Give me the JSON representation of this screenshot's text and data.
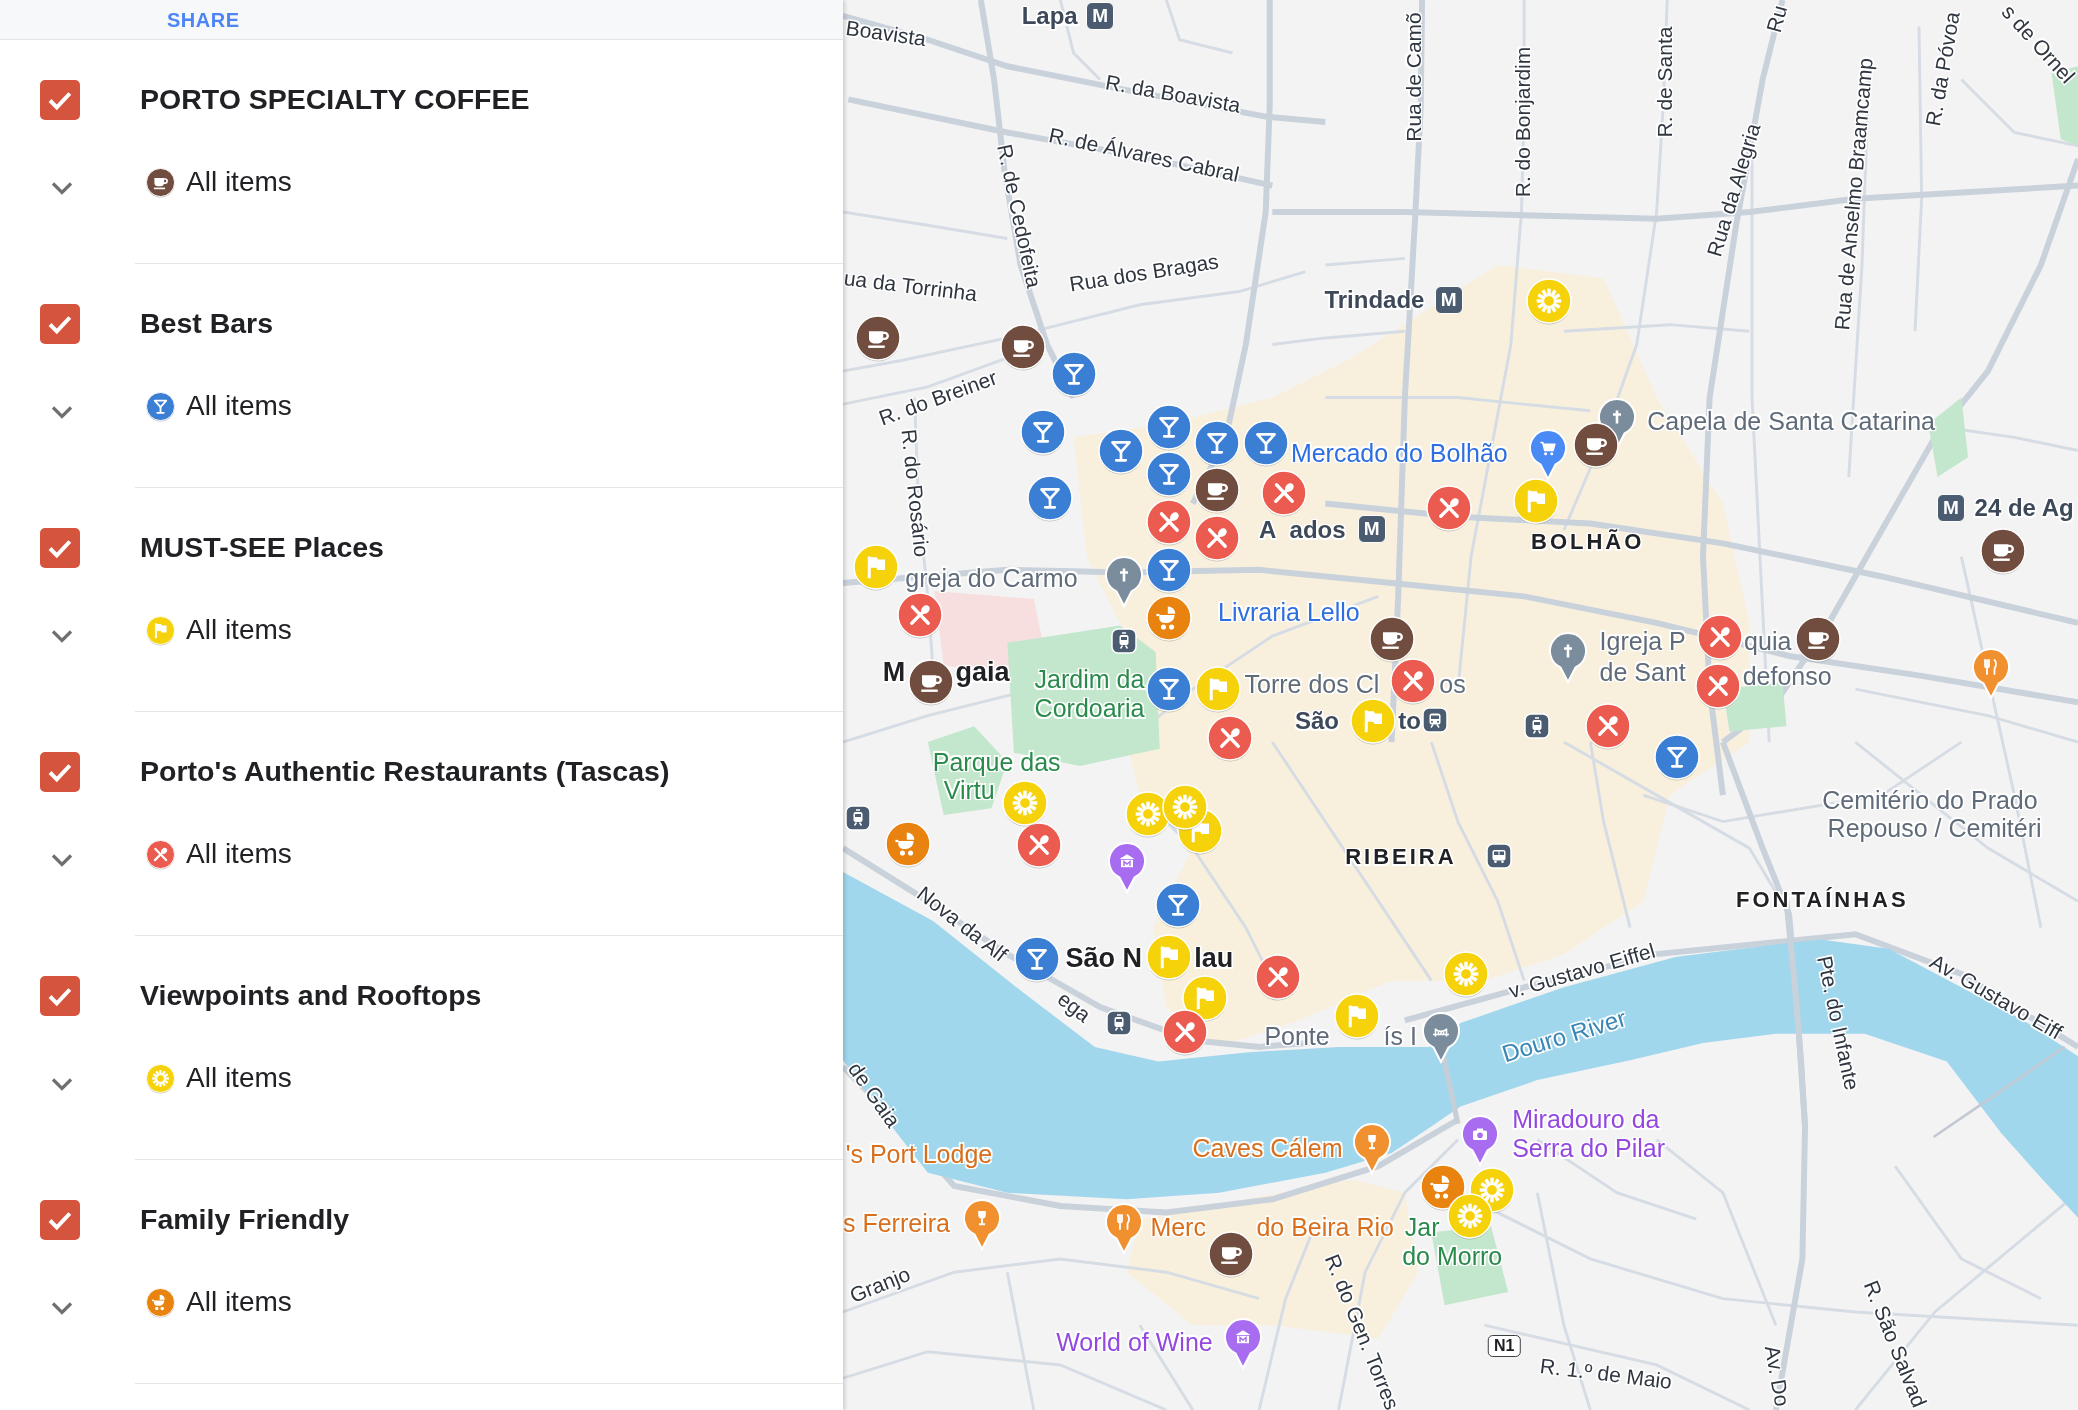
{
  "panel": {
    "share_label": "SHARE"
  },
  "layers": [
    {
      "title": "PORTO SPECIALTY COFFEE",
      "kind": "coffee",
      "color": "#714d3f",
      "checked": true,
      "expanded": false,
      "items_label": "All items"
    },
    {
      "title": "Best Bars",
      "kind": "bar",
      "color": "#3b7fd4",
      "checked": true,
      "expanded": false,
      "items_label": "All items"
    },
    {
      "title": "MUST-SEE Places",
      "kind": "sight",
      "color": "#f5d20a",
      "checked": true,
      "expanded": false,
      "items_label": "All items"
    },
    {
      "title": "Porto's Authentic Restaurants (Tascas)",
      "kind": "restaurant",
      "color": "#ec5b4f",
      "checked": true,
      "expanded": false,
      "items_label": "All items"
    },
    {
      "title": "Viewpoints and Rooftops",
      "kind": "viewpoint",
      "color": "#f5d20a",
      "checked": true,
      "expanded": false,
      "items_label": "All items"
    },
    {
      "title": "Family Friendly",
      "kind": "family",
      "color": "#e8830f",
      "checked": true,
      "expanded": false,
      "items_label": "All items"
    }
  ],
  "map": {
    "labels": [
      {
        "text": "Lapa",
        "kind": "station"
      },
      {
        "text": "Boavista",
        "kind": "street"
      },
      {
        "text": "R. da Boavista",
        "kind": "street"
      },
      {
        "text": "R. de Álvares Cabral",
        "kind": "street"
      },
      {
        "text": "R. de Cedofeita",
        "kind": "street"
      },
      {
        "text": "ua da Torrinha",
        "kind": "street"
      },
      {
        "text": "Rua dos Bragas",
        "kind": "street"
      },
      {
        "text": "R. do Breiner",
        "kind": "street"
      },
      {
        "text": "R. do Rosário",
        "kind": "street"
      },
      {
        "text": "Rua de Camõ",
        "kind": "street"
      },
      {
        "text": "R. do Bonjardim",
        "kind": "street"
      },
      {
        "text": "R. de Santa",
        "kind": "street"
      },
      {
        "text": "Rua da Alegria",
        "kind": "street"
      },
      {
        "text": "Ru",
        "kind": "street"
      },
      {
        "text": "Rua de Anselmo Braamcamp",
        "kind": "street"
      },
      {
        "text": "R. da Póvoa",
        "kind": "street"
      },
      {
        "text": "s de Ornel",
        "kind": "street"
      },
      {
        "text": "Trindade",
        "kind": "station"
      },
      {
        "text": "Mercado do Bolhão",
        "kind": "shop"
      },
      {
        "text": "Capela de Santa Catarina",
        "kind": "place"
      },
      {
        "text": "A",
        "kind": "station"
      },
      {
        "text": "ados",
        "kind": "station"
      },
      {
        "text": "BOLHÃO",
        "kind": "district"
      },
      {
        "text": "24 de Ag",
        "kind": "station"
      },
      {
        "text": "greja do Carmo",
        "kind": "place"
      },
      {
        "text": "M",
        "kind": "neighborhood"
      },
      {
        "text": "gaia",
        "kind": "neighborhood"
      },
      {
        "text": "Jardim da Cordoaria",
        "kind": "park"
      },
      {
        "text": "Livraria Lello",
        "kind": "shop"
      },
      {
        "text": "Torre dos Cl",
        "kind": "place"
      },
      {
        "text": "os",
        "kind": "place"
      },
      {
        "text": "São",
        "kind": "station"
      },
      {
        "text": "to",
        "kind": "station"
      },
      {
        "text": "Igreja P",
        "kind": "place"
      },
      {
        "text": "quia",
        "kind": "place"
      },
      {
        "text": "de Sant",
        "kind": "place"
      },
      {
        "text": "defonso",
        "kind": "place"
      },
      {
        "text": "Parque das",
        "kind": "park"
      },
      {
        "text": "Virtu",
        "kind": "park"
      },
      {
        "text": "RIBEIRA",
        "kind": "district"
      },
      {
        "text": "Cemitério do Prado",
        "kind": "place"
      },
      {
        "text": "Repouso / Cemitéri",
        "kind": "place"
      },
      {
        "text": "FONTAÍNHAS",
        "kind": "district"
      },
      {
        "text": "Nova da Alf",
        "kind": "street"
      },
      {
        "text": "ega",
        "kind": "street"
      },
      {
        "text": "São N",
        "kind": "neighborhood"
      },
      {
        "text": "lau",
        "kind": "neighborhood"
      },
      {
        "text": "v. Gustavo Eiffel",
        "kind": "street"
      },
      {
        "text": "Douro River",
        "kind": "water"
      },
      {
        "text": "Av. Gustavo Eiff",
        "kind": "street"
      },
      {
        "text": "Ponte",
        "kind": "place"
      },
      {
        "text": "ís I",
        "kind": "place"
      },
      {
        "text": "Pte. do Infante",
        "kind": "street"
      },
      {
        "text": "de Gaia",
        "kind": "street"
      },
      {
        "text": "'s Port Lodge",
        "kind": "food"
      },
      {
        "text": "Caves Cálem",
        "kind": "food"
      },
      {
        "text": "Miradouro da Serra do Pilar",
        "kind": "attraction"
      },
      {
        "text": "s Ferreira",
        "kind": "food"
      },
      {
        "text": "Merc",
        "kind": "food"
      },
      {
        "text": "do Beira Rio",
        "kind": "food"
      },
      {
        "text": "Jar",
        "kind": "park"
      },
      {
        "text": "do Morro",
        "kind": "park"
      },
      {
        "text": "Granjo",
        "kind": "street"
      },
      {
        "text": "R. do Gen. Torres",
        "kind": "street"
      },
      {
        "text": "World of Wine",
        "kind": "attraction"
      },
      {
        "text": "R. 1.º de Maio",
        "kind": "street"
      },
      {
        "text": "Av. Do",
        "kind": "street"
      },
      {
        "text": "R. São Salvad",
        "kind": "street"
      }
    ],
    "metro_signs": [
      {
        "text": "M"
      },
      {
        "text": "M"
      },
      {
        "text": "M"
      },
      {
        "text": "M"
      }
    ],
    "road_signs": [
      {
        "text": "N1"
      }
    ],
    "markers": [
      {
        "kind": "coffee"
      },
      {
        "kind": "coffee"
      },
      {
        "kind": "coffee"
      },
      {
        "kind": "coffee"
      },
      {
        "kind": "coffee"
      },
      {
        "kind": "coffee"
      },
      {
        "kind": "coffee"
      },
      {
        "kind": "coffee"
      },
      {
        "kind": "coffee"
      },
      {
        "kind": "bar"
      },
      {
        "kind": "bar"
      },
      {
        "kind": "bar"
      },
      {
        "kind": "bar"
      },
      {
        "kind": "bar"
      },
      {
        "kind": "bar"
      },
      {
        "kind": "bar"
      },
      {
        "kind": "bar"
      },
      {
        "kind": "bar"
      },
      {
        "kind": "bar"
      },
      {
        "kind": "bar"
      },
      {
        "kind": "bar"
      },
      {
        "kind": "bar"
      },
      {
        "kind": "sight"
      },
      {
        "kind": "sight"
      },
      {
        "kind": "sight"
      },
      {
        "kind": "sight"
      },
      {
        "kind": "sight"
      },
      {
        "kind": "sight"
      },
      {
        "kind": "sight"
      },
      {
        "kind": "sight"
      },
      {
        "kind": "family"
      },
      {
        "kind": "family"
      },
      {
        "kind": "family"
      },
      {
        "kind": "restaurant"
      },
      {
        "kind": "restaurant"
      },
      {
        "kind": "restaurant"
      },
      {
        "kind": "restaurant"
      },
      {
        "kind": "restaurant"
      },
      {
        "kind": "restaurant"
      },
      {
        "kind": "restaurant"
      },
      {
        "kind": "restaurant"
      },
      {
        "kind": "restaurant"
      },
      {
        "kind": "restaurant"
      },
      {
        "kind": "restaurant"
      },
      {
        "kind": "restaurant"
      },
      {
        "kind": "restaurant"
      },
      {
        "kind": "viewpoint"
      },
      {
        "kind": "viewpoint"
      },
      {
        "kind": "viewpoint"
      },
      {
        "kind": "viewpoint"
      },
      {
        "kind": "viewpoint"
      },
      {
        "kind": "viewpoint"
      },
      {
        "kind": "viewpoint"
      }
    ]
  }
}
